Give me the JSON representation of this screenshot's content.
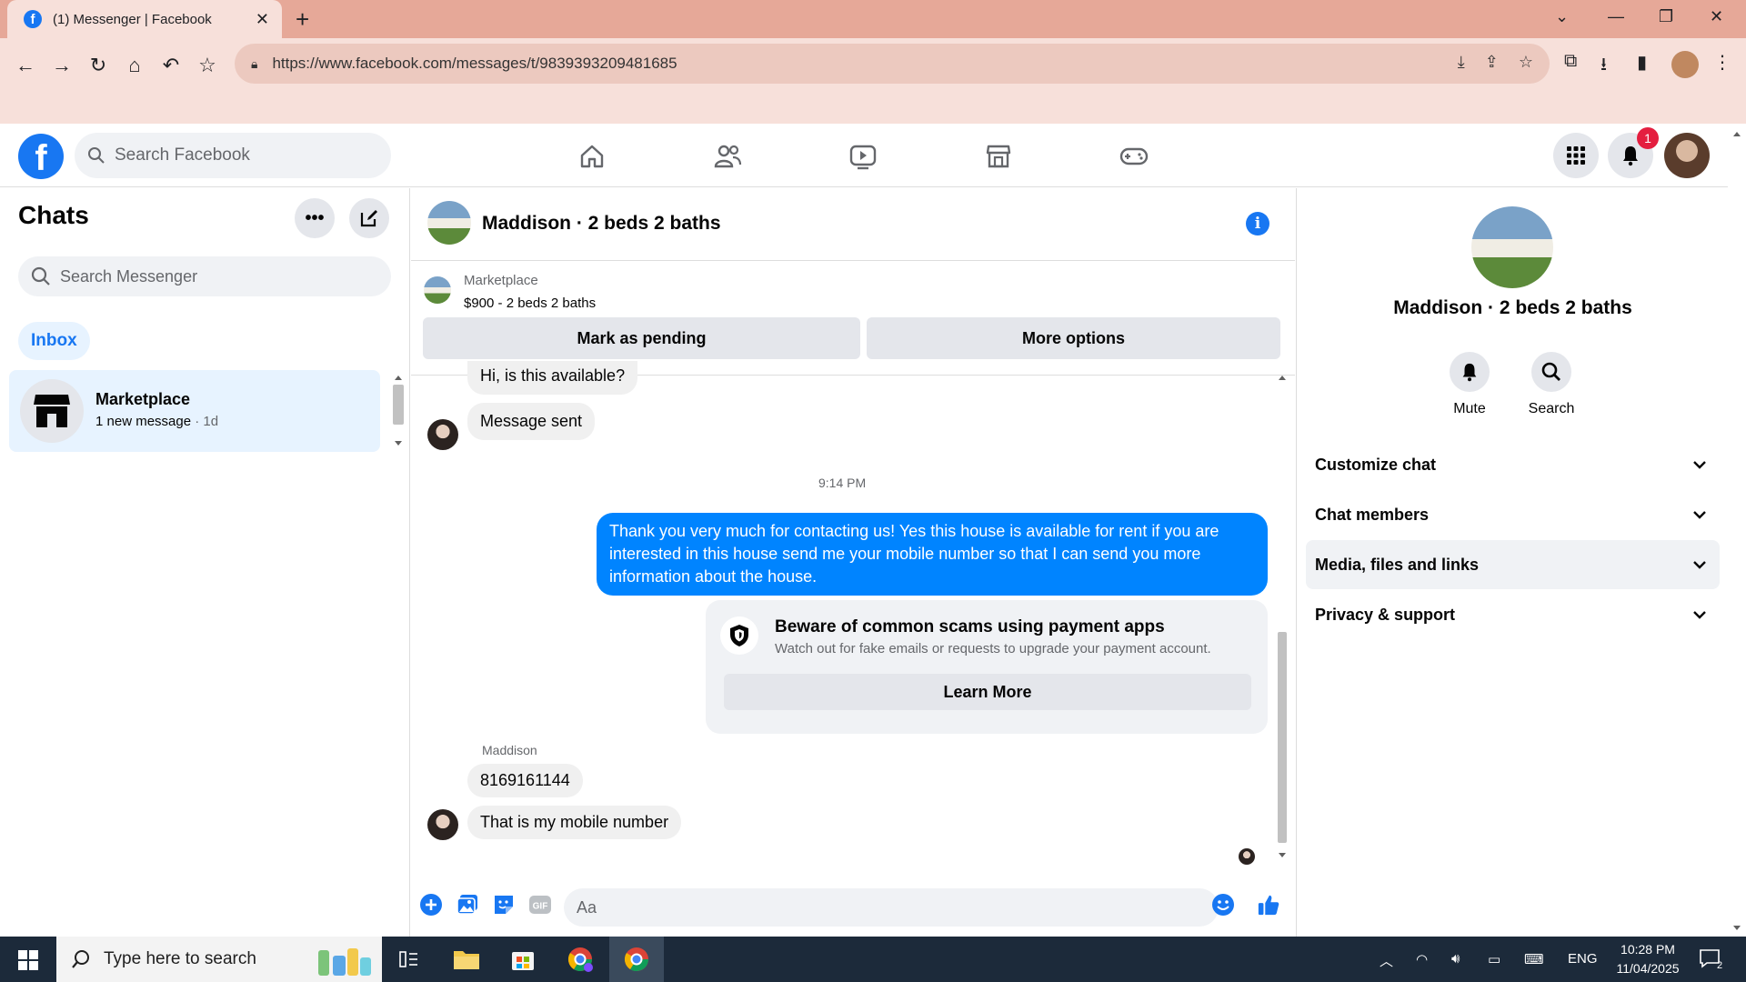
{
  "browser": {
    "tab_title": "(1) Messenger | Facebook",
    "url": "https://www.facebook.com/messages/t/9839393209481685"
  },
  "fb": {
    "search_placeholder": "Search Facebook",
    "notification_count": "1"
  },
  "chats": {
    "title": "Chats",
    "search_placeholder": "Search Messenger",
    "filter": "Inbox",
    "threads": [
      {
        "name": "Marketplace",
        "preview": "1 new message",
        "time": " · 1d"
      }
    ]
  },
  "conversation": {
    "title": "Maddison · 2 beds 2 baths",
    "marketplace_label": "Marketplace",
    "listing": "$900 - 2 beds 2 baths",
    "mark_pending": "Mark as pending",
    "more_options": "More options",
    "messages": {
      "m1": "Hi, is this available?",
      "m2": "Message sent",
      "time": "9:14 PM",
      "m3": "Thank you very much for contacting us! Yes this house is available for rent if you are interested in this house send me your mobile number so that I can send you more information about the house.",
      "scam_title": "Beware of common scams using payment apps",
      "scam_body": "Watch out for fake emails or requests to upgrade your payment account.",
      "learn_more": "Learn More",
      "sender": "Maddison",
      "m4": "8169161144",
      "m5": "That is my mobile number"
    },
    "composer_placeholder": "Aa"
  },
  "details": {
    "name": "Maddison · 2 beds 2 baths",
    "mute": "Mute",
    "search": "Search",
    "sections": [
      "Customize chat",
      "Chat members",
      "Media, files and links",
      "Privacy & support"
    ]
  },
  "taskbar": {
    "search_placeholder": "Type here to search",
    "lang": "ENG",
    "time": "10:28 PM",
    "date": "11/04/2025",
    "notif": "2"
  },
  "colors": {
    "brand": "#1877f2",
    "outgoing_bubble": "#0084ff",
    "chrome_tabbar": "#e6a898",
    "chrome_toolbar": "#f7e0da"
  }
}
